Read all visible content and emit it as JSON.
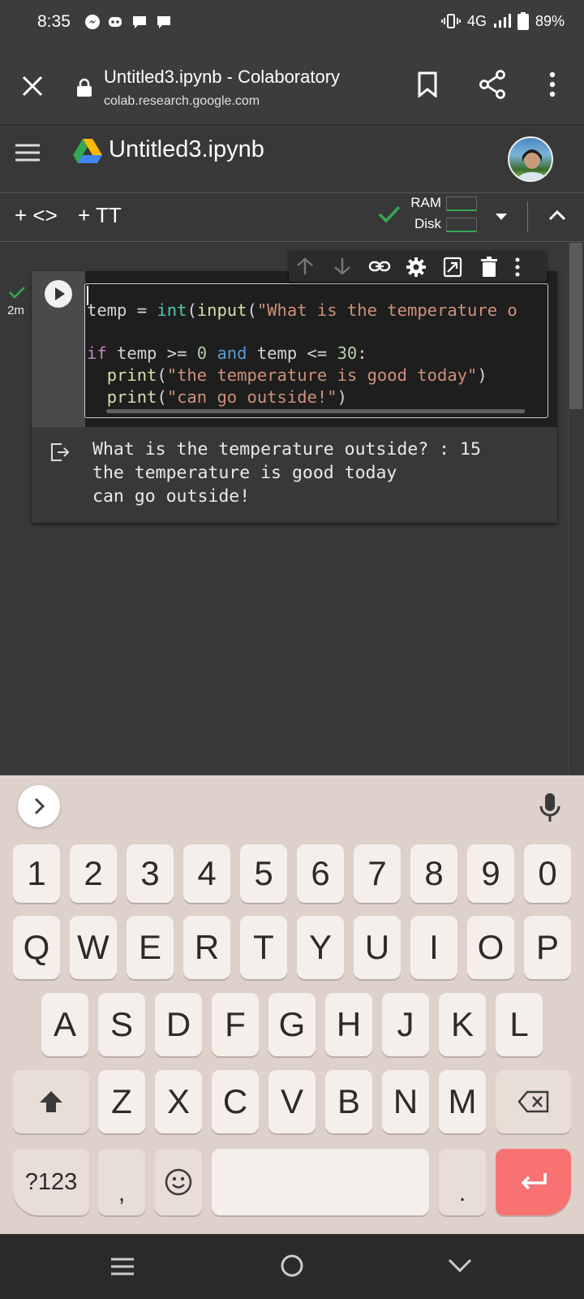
{
  "status_bar": {
    "time": "8:35",
    "network": "4G",
    "battery": "89%"
  },
  "browser": {
    "page_title": "Untitled3.ipynb - Colaboratory",
    "url": "colab.research.google.com"
  },
  "colab": {
    "notebook_title": "Untitled3.ipynb",
    "toolbar": {
      "add_code_label": "+ <>",
      "add_text_label": "+ TT",
      "ram_label": "RAM",
      "disk_label": "Disk"
    },
    "cell": {
      "exec_time": "2m",
      "code_lines": [
        "temp = int(input(\"What is the temperature o",
        "",
        "if temp >= 0 and temp <= 30:",
        "  print(\"the temperature is good today\")",
        "  print(\"can go outside!\")"
      ],
      "output_lines": [
        "What is the temperature outside? : 15",
        "the temperature is good today",
        "can go outside!"
      ]
    }
  },
  "keyboard": {
    "number_row": [
      "1",
      "2",
      "3",
      "4",
      "5",
      "6",
      "7",
      "8",
      "9",
      "0"
    ],
    "row1": [
      "Q",
      "W",
      "E",
      "R",
      "T",
      "Y",
      "U",
      "I",
      "O",
      "P"
    ],
    "row2": [
      "A",
      "S",
      "D",
      "F",
      "G",
      "H",
      "J",
      "K",
      "L"
    ],
    "row3": [
      "Z",
      "X",
      "C",
      "V",
      "B",
      "N",
      "M"
    ],
    "symbols_key": "?123",
    "comma_key": ",",
    "period_key": "."
  },
  "colors": {
    "accent_check": "#34a853",
    "enter_key": "#f87272",
    "code_string": "#ce9178",
    "code_keyword": "#c586c0"
  }
}
